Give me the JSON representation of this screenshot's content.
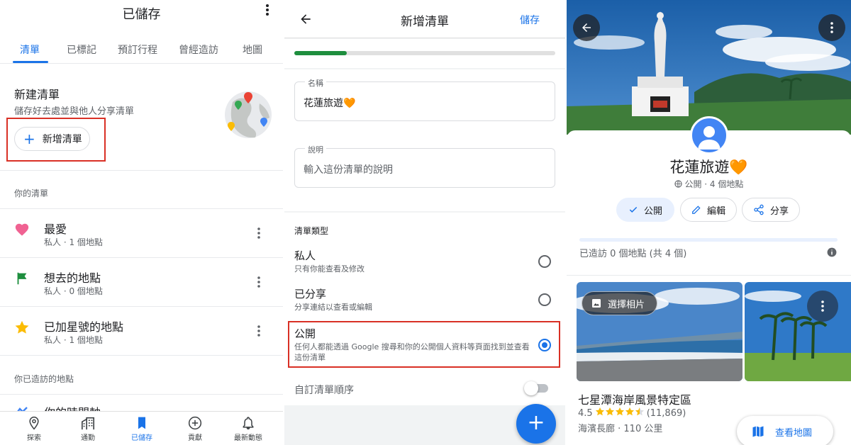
{
  "saved": {
    "title": "已儲存",
    "tabs": [
      "清單",
      "已標記",
      "預訂行程",
      "曾經造訪",
      "地圖"
    ],
    "active_tab": 0,
    "new_list": {
      "title": "新建清單",
      "subtitle": "儲存好去處並與他人分享清單",
      "button": "新增清單"
    },
    "your_lists_label": "你的清單",
    "lists": [
      {
        "name": "最愛",
        "meta": "私人 · 1 個地點",
        "icon": "heart-icon",
        "color": "#f06292"
      },
      {
        "name": "想去的地點",
        "meta": "私人 · 0 個地點",
        "icon": "flag-icon",
        "color": "#1e8e3e"
      },
      {
        "name": "已加星號的地點",
        "meta": "私人 · 1 個地點",
        "icon": "star-icon",
        "color": "#fbbc04"
      }
    ],
    "visited_label": "你已造訪的地點",
    "timeline_label": "你的時間軸",
    "nav": [
      "探索",
      "通勤",
      "已儲存",
      "貢獻",
      "最新動態"
    ],
    "active_nav": 2
  },
  "new_list_form": {
    "title": "新增清單",
    "save": "儲存",
    "progress": 0.2,
    "name_label": "名稱",
    "name_value": "花蓮旅遊🧡",
    "desc_label": "說明",
    "desc_placeholder": "輸入這份清單的說明",
    "type_label": "清單類型",
    "types": [
      {
        "title": "私人",
        "sub": "只有你能查看及修改",
        "selected": false
      },
      {
        "title": "已分享",
        "sub": "分享連結以查看或編輯",
        "selected": false
      },
      {
        "title": "公開",
        "sub": "任何人都能透過 Google 搜尋和你的公開個人資料等頁面找到並查看這份清單",
        "selected": true
      }
    ],
    "custom_order": "自訂清單順序",
    "custom_order_on": false
  },
  "list_detail": {
    "title": "花蓮旅遊🧡",
    "meta": "公開 · 4 個地點",
    "chips": [
      "公開",
      "編輯",
      "分享"
    ],
    "visited": "已造訪 0 個地點 (共 4 個)",
    "visited_fraction": 0,
    "choose_photo": "選擇相片",
    "place": {
      "name": "七星潭海岸風景特定區",
      "rating": "4.5",
      "stars": 4.5,
      "reviews": "(11,869)",
      "meta": "海濱長廊 · 110 公里"
    },
    "view_map": "查看地圖"
  },
  "colors": {
    "accent": "#1a73e8",
    "highlight_border": "#d93025"
  }
}
